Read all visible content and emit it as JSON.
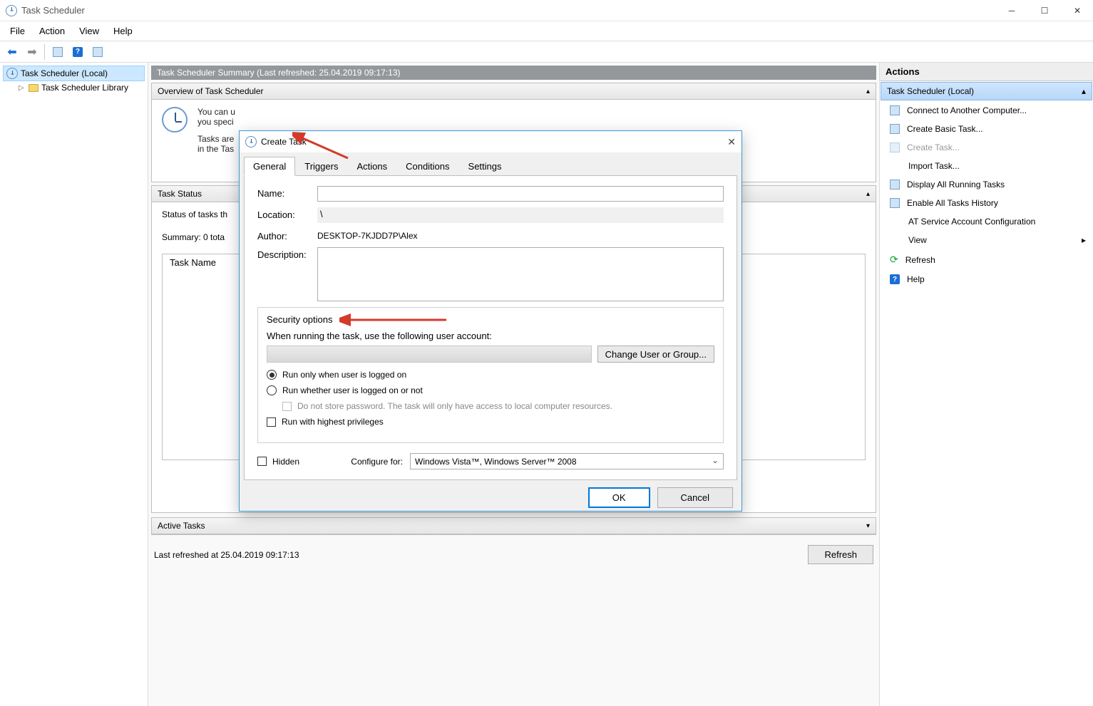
{
  "window": {
    "title": "Task Scheduler"
  },
  "menu": {
    "file": "File",
    "action": "Action",
    "view": "View",
    "help": "Help"
  },
  "tree": {
    "root": "Task Scheduler (Local)",
    "library": "Task Scheduler Library"
  },
  "summary": {
    "header": "Task Scheduler Summary (Last refreshed: 25.04.2019 09:17:13)",
    "overview_title": "Overview of Task Scheduler",
    "overview_line1": "You can u",
    "overview_line2": "you speci",
    "overview_line3": "Tasks are",
    "overview_line4": "in the Tas",
    "taskstatus_title": "Task Status",
    "status_text": "Status of tasks th",
    "summary_text": "Summary: 0 tota",
    "taskname_header": "Task Name",
    "active_title": "Active Tasks",
    "lastrefresh": "Last refreshed at 25.04.2019 09:17:13",
    "refresh_btn": "Refresh"
  },
  "actions": {
    "header": "Actions",
    "context": "Task Scheduler (Local)",
    "items": {
      "connect": "Connect to Another Computer...",
      "create_basic": "Create Basic Task...",
      "create_task": "Create Task...",
      "import_task": "Import Task...",
      "display_running": "Display All Running Tasks",
      "enable_history": "Enable All Tasks History",
      "at_config": "AT Service Account Configuration",
      "view": "View",
      "refresh": "Refresh",
      "help": "Help"
    }
  },
  "dialog": {
    "title": "Create Task",
    "tabs": {
      "general": "General",
      "triggers": "Triggers",
      "actions": "Actions",
      "conditions": "Conditions",
      "settings": "Settings"
    },
    "labels": {
      "name": "Name:",
      "location": "Location:",
      "author": "Author:",
      "description": "Description:"
    },
    "values": {
      "name": "",
      "location": "\\",
      "author": "DESKTOP-7KJDD7P\\Alex",
      "description": ""
    },
    "security": {
      "legend": "Security options",
      "when_running": "When running the task, use the following user account:",
      "change_btn": "Change User or Group...",
      "run_logged_on": "Run only when user is logged on",
      "run_whether": "Run whether user is logged on or not",
      "do_not_store": "Do not store password.  The task will only have access to local computer resources.",
      "highest_priv": "Run with highest privileges"
    },
    "hidden_label": "Hidden",
    "configure_label": "Configure for:",
    "configure_value": "Windows Vista™, Windows Server™ 2008",
    "ok": "OK",
    "cancel": "Cancel"
  }
}
